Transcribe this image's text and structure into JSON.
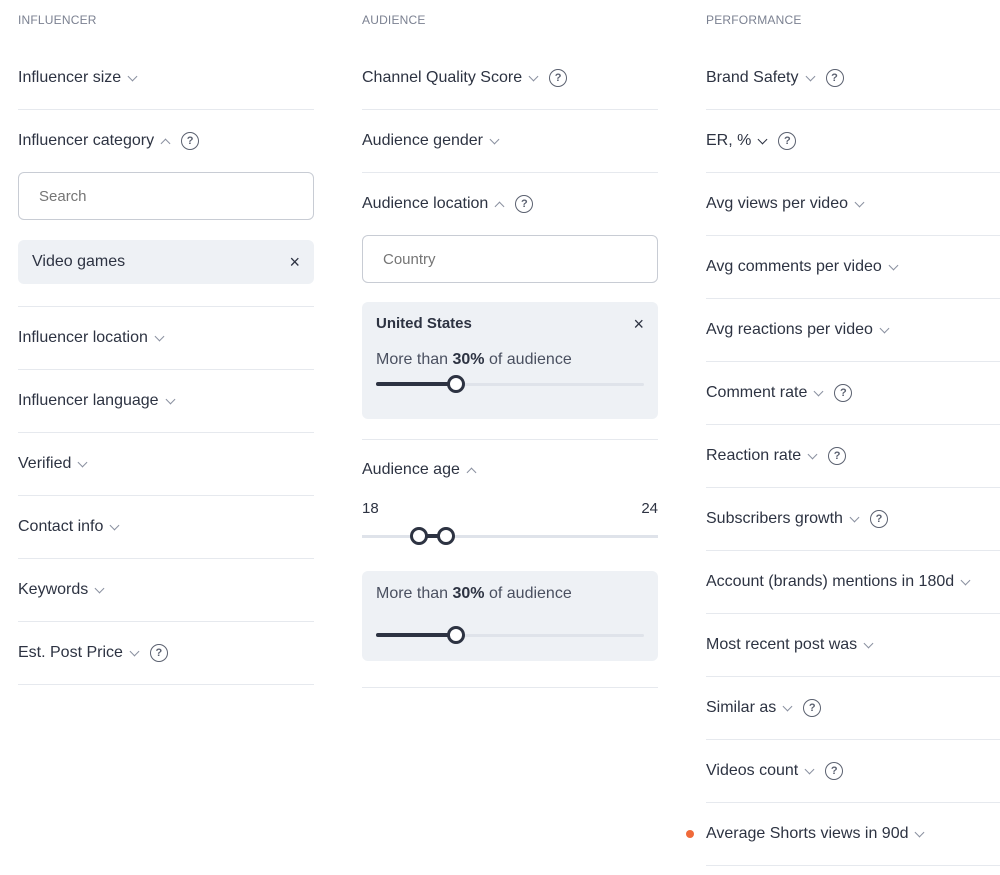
{
  "columns": {
    "influencer": {
      "heading": "INFLUENCER",
      "size_label": "Influencer size",
      "category_label": "Influencer category",
      "search_placeholder": "Search",
      "chip_label": "Video games",
      "location_label": "Influencer location",
      "language_label": "Influencer language",
      "verified_label": "Verified",
      "contact_label": "Contact info",
      "keywords_label": "Keywords",
      "price_label": "Est. Post Price"
    },
    "audience": {
      "heading": "AUDIENCE",
      "quality_label": "Channel Quality Score",
      "gender_label": "Audience gender",
      "location_label": "Audience location",
      "country_placeholder": "Country",
      "location_card": {
        "country": "United States",
        "prefix": "More than",
        "percent": "30%",
        "suffix": "of audience",
        "slider_value": 0.3
      },
      "age_label": "Audience age",
      "age_min": "18",
      "age_max": "24",
      "age_card": {
        "prefix": "More than",
        "percent": "30%",
        "suffix": "of audience",
        "slider_value": 0.3
      }
    },
    "performance": {
      "heading": "PERFORMANCE",
      "items": [
        "Brand Safety",
        "ER, %",
        "Avg views per video",
        "Avg comments per video",
        "Avg reactions per video",
        "Comment rate",
        "Reaction rate",
        "Subscribers growth",
        "Account (brands) mentions in 180d",
        "Most recent post was",
        "Similar as",
        "Videos count",
        "Average Shorts views in 90d"
      ]
    }
  },
  "icons": {
    "help": "?",
    "close": "×"
  },
  "colors": {
    "text": "#2d3342",
    "muted": "#7b8191",
    "chip_bg": "#eef1f5",
    "new_dot": "#f06a3a"
  }
}
